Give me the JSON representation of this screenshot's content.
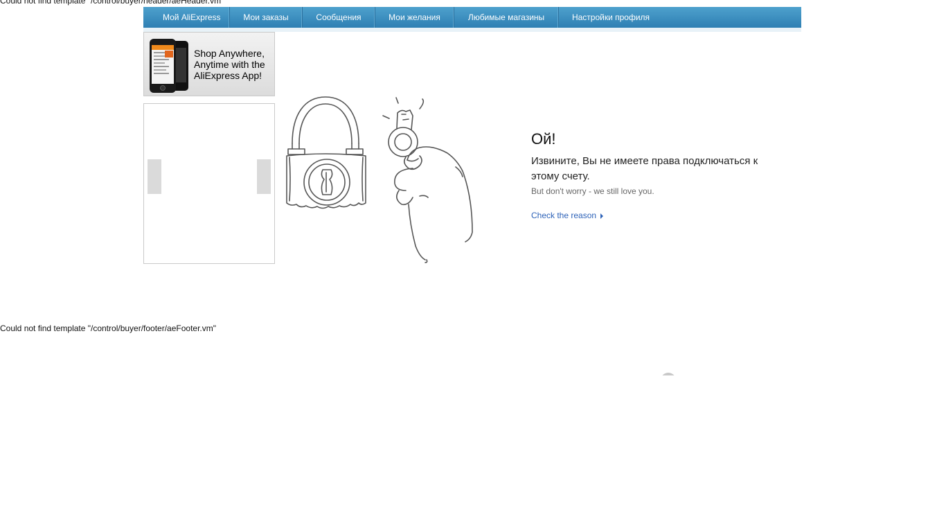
{
  "errors": {
    "header": "Could not find template \"/control/buyer/header/aeHeader.vm\"",
    "footer": "Could not find template \"/control/buyer/footer/aeFooter.vm\""
  },
  "nav": {
    "items": [
      {
        "label": "Мой AliExpress"
      },
      {
        "label": "Мои заказы"
      },
      {
        "label": "Сообщения"
      },
      {
        "label": "Мои желания"
      },
      {
        "label": "Любимые магазины"
      },
      {
        "label": "Настройки профиля"
      }
    ]
  },
  "banner": {
    "text": "Shop Anywhere, Anytime with the AliExpress App!"
  },
  "message": {
    "title": "Ой!",
    "subtitle": "Извините, Вы не имеете права подключаться к этому счету.",
    "note": "But don't worry - we still love you.",
    "link": "Check the reason"
  },
  "colors": {
    "nav_top": "#4ea1cd",
    "nav_bottom": "#2e7fb3",
    "link": "#2d62b8"
  },
  "icons": [
    "phone-icon",
    "padlock-icon",
    "key-in-hand-icon",
    "arrow-right-icon"
  ]
}
